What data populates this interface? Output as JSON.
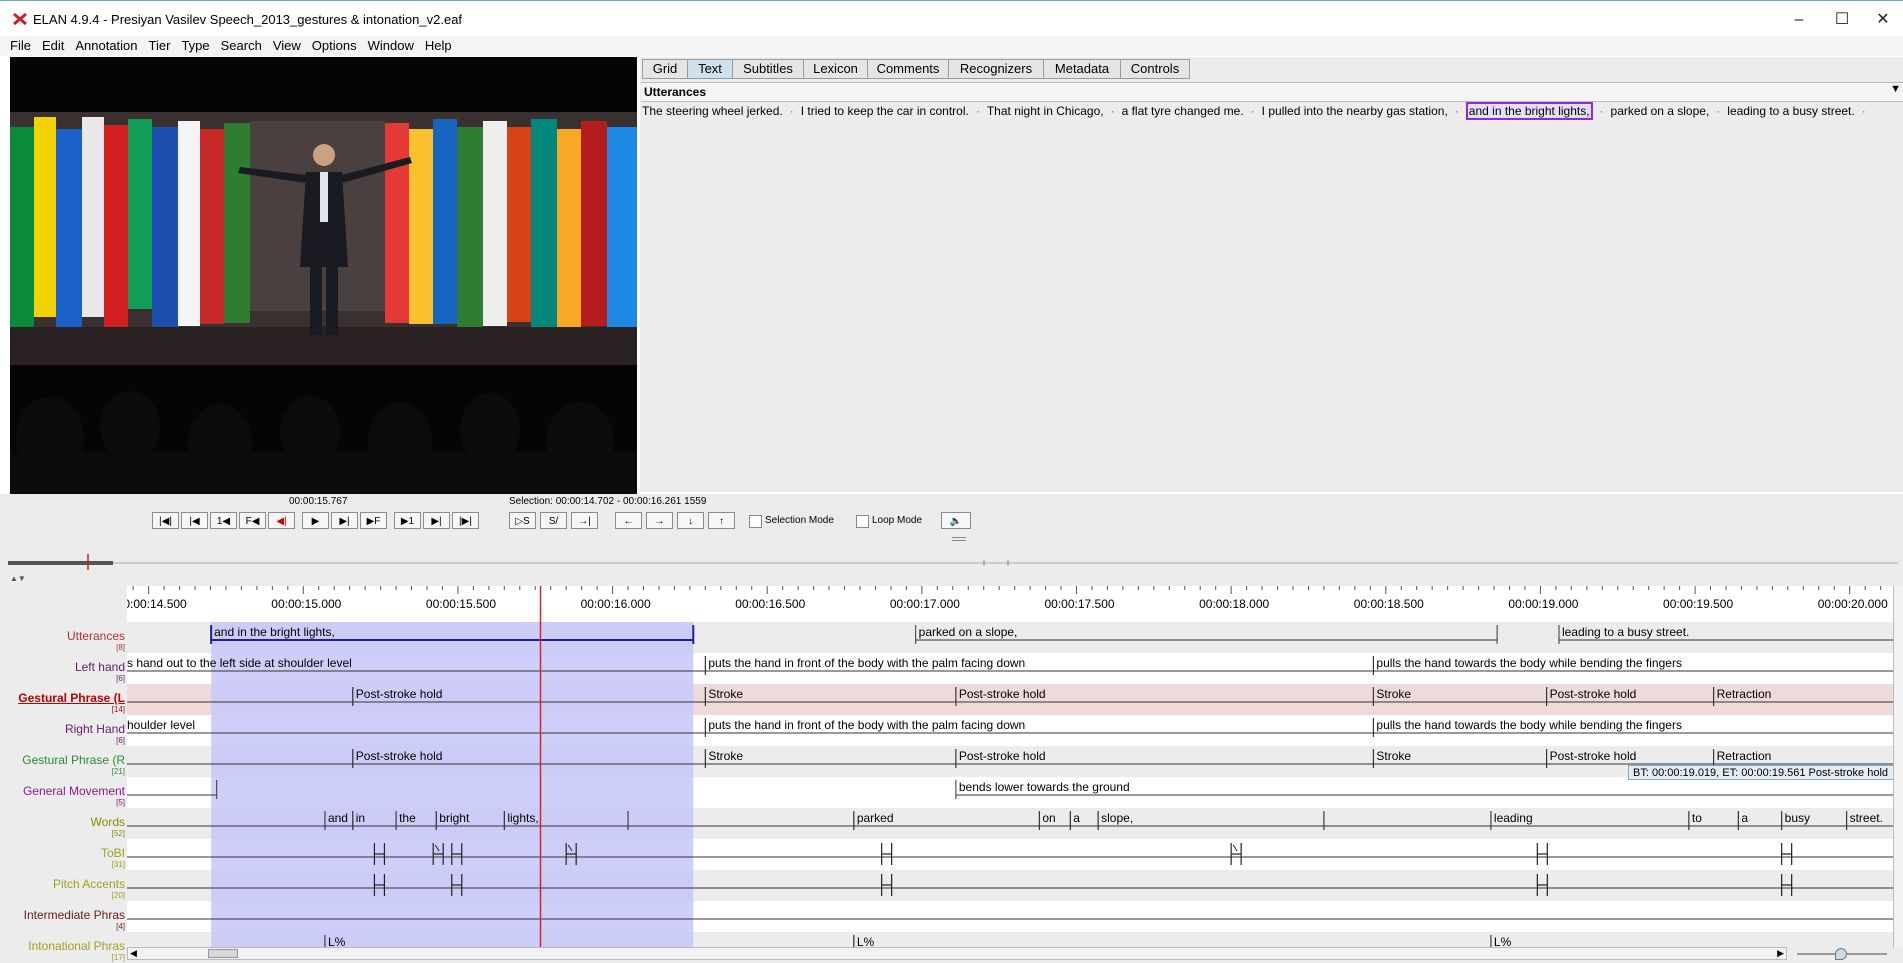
{
  "window": {
    "title": "ELAN 4.9.4 - Presiyan Vasilev Speech_2013_gestures & intonation_v2.eaf",
    "icon": "elan-logo-icon",
    "controls": [
      "minimize-icon",
      "maximize-icon",
      "close-icon"
    ]
  },
  "menu": [
    "File",
    "Edit",
    "Annotation",
    "Tier",
    "Type",
    "Search",
    "View",
    "Options",
    "Window",
    "Help"
  ],
  "tabs": [
    "Grid",
    "Text",
    "Subtitles",
    "Lexicon",
    "Comments",
    "Recognizers",
    "Metadata",
    "Controls"
  ],
  "active_tab": "Text",
  "text_view": {
    "tier": "Utterances",
    "utterances": [
      "The steering wheel jerked.",
      "I tried to keep the car in control.",
      "That night in Chicago,",
      "a flat tyre changed me.",
      "I pulled into the nearby gas station,",
      "and in the bright lights,",
      "parked on a slope,",
      "leading to a busy street."
    ],
    "selected_index": 5,
    "separator": "·"
  },
  "media": {
    "current_time": "00:00:15.767",
    "selection": "Selection: 00:00:14.702 - 00:00:16.261  1559",
    "selection_mode_label": "Selection Mode",
    "loop_mode_label": "Loop Mode",
    "selection_mode": false,
    "loop_mode": false
  },
  "timeline": {
    "view_start": 14.43,
    "view_end": 20.14,
    "crosshair": 15.767,
    "selection": [
      14.702,
      16.261
    ],
    "ticks": [
      "00:00:14.500",
      "00:00:15.000",
      "00:00:15.500",
      "00:00:16.000",
      "00:00:16.500",
      "00:00:17.000",
      "00:00:17.500",
      "00:00:18.000",
      "00:00:18.500",
      "00:00:19.000",
      "00:00:19.500",
      "00:00:20.000"
    ],
    "tick_times": [
      14.5,
      15.0,
      15.5,
      16.0,
      16.5,
      17.0,
      17.5,
      18.0,
      18.5,
      19.0,
      19.5,
      20.0
    ],
    "tooltip": "BT: 00:00:19.019, ET: 00:00:19.561 Post-stroke hold",
    "tiers": [
      {
        "name": "Utterances",
        "count": "[8]",
        "color": "#b0303c",
        "bold": false,
        "shaded": true,
        "anns": [
          {
            "s": 14.702,
            "e": 16.261,
            "t": "and in the bright lights,",
            "sel": true
          },
          {
            "s": 16.98,
            "e": 18.86,
            "t": "parked on a slope,"
          },
          {
            "s": 19.06,
            "e": 20.3,
            "t": "leading to a busy street."
          }
        ]
      },
      {
        "name": "Left hand",
        "count": "[6]",
        "color": "#6a1b6a",
        "bold": false,
        "shaded": false,
        "anns": [
          {
            "s": 14.0,
            "e": 16.3,
            "t": "s hand out to the left side at shoulder level"
          },
          {
            "s": 16.3,
            "e": 18.46,
            "t": "puts the hand in front of the body with the palm facing down"
          },
          {
            "s": 18.46,
            "e": 20.3,
            "t": "pulls the hand towards the body while bending the fingers"
          }
        ]
      },
      {
        "name": "Gestural Phrase (L",
        "count": "[14]",
        "color": "#c00000",
        "bold": true,
        "shaded": true,
        "active": true,
        "anns": [
          {
            "s": 14.0,
            "e": 15.16,
            "t": ""
          },
          {
            "s": 15.16,
            "e": 16.3,
            "t": "Post-stroke hold"
          },
          {
            "s": 16.3,
            "e": 17.11,
            "t": "Stroke"
          },
          {
            "s": 17.11,
            "e": 18.46,
            "t": "Post-stroke hold"
          },
          {
            "s": 18.46,
            "e": 19.02,
            "t": "Stroke"
          },
          {
            "s": 19.02,
            "e": 19.56,
            "t": "Post-stroke hold"
          },
          {
            "s": 19.56,
            "e": 20.3,
            "t": "Retraction"
          }
        ]
      },
      {
        "name": "Right Hand",
        "count": "[6]",
        "color": "#6a1b6a",
        "bold": false,
        "shaded": false,
        "anns": [
          {
            "s": 14.0,
            "e": 16.3,
            "t": "houlder level"
          },
          {
            "s": 16.3,
            "e": 18.46,
            "t": "puts the hand in front of the body with the palm facing down"
          },
          {
            "s": 18.46,
            "e": 20.3,
            "t": "pulls the hand towards the body while bending the fingers"
          }
        ]
      },
      {
        "name": "Gestural Phrase (R",
        "count": "[21]",
        "color": "#2e8b2e",
        "bold": false,
        "shaded": true,
        "anns": [
          {
            "s": 14.0,
            "e": 15.16,
            "t": ""
          },
          {
            "s": 15.16,
            "e": 16.3,
            "t": "Post-stroke hold"
          },
          {
            "s": 16.3,
            "e": 17.11,
            "t": "Stroke"
          },
          {
            "s": 17.11,
            "e": 18.46,
            "t": "Post-stroke hold"
          },
          {
            "s": 18.46,
            "e": 19.02,
            "t": "Stroke"
          },
          {
            "s": 19.02,
            "e": 19.56,
            "t": "Post-stroke hold"
          },
          {
            "s": 19.56,
            "e": 20.3,
            "t": "Retraction"
          }
        ]
      },
      {
        "name": "General Movement",
        "count": "[5]",
        "color": "#8b1a8b",
        "bold": false,
        "shaded": false,
        "anns": [
          {
            "s": 14.0,
            "e": 14.72,
            "t": ""
          },
          {
            "s": 17.11,
            "e": 20.3,
            "t": "bends lower towards the ground"
          }
        ]
      },
      {
        "name": "Words",
        "count": "[52]",
        "color": "#8a8a00",
        "bold": false,
        "shaded": true,
        "anns": [
          {
            "s": 14.0,
            "e": 15.07,
            "t": ""
          },
          {
            "s": 15.07,
            "e": 15.16,
            "t": "and"
          },
          {
            "s": 15.16,
            "e": 15.3,
            "t": "in"
          },
          {
            "s": 15.3,
            "e": 15.43,
            "t": "the"
          },
          {
            "s": 15.43,
            "e": 15.65,
            "t": "bright"
          },
          {
            "s": 15.65,
            "e": 16.05,
            "t": "lights,"
          },
          {
            "s": 16.05,
            "e": 16.78,
            "t": ""
          },
          {
            "s": 16.78,
            "e": 17.38,
            "t": "parked"
          },
          {
            "s": 17.38,
            "e": 17.48,
            "t": "on"
          },
          {
            "s": 17.48,
            "e": 17.57,
            "t": "a"
          },
          {
            "s": 17.57,
            "e": 18.3,
            "t": "slope,"
          },
          {
            "s": 18.3,
            "e": 18.84,
            "t": ""
          },
          {
            "s": 18.84,
            "e": 19.48,
            "t": "leading"
          },
          {
            "s": 19.48,
            "e": 19.64,
            "t": "to"
          },
          {
            "s": 19.64,
            "e": 19.78,
            "t": "a"
          },
          {
            "s": 19.78,
            "e": 19.99,
            "t": "busy"
          },
          {
            "s": 19.99,
            "e": 20.3,
            "t": "street."
          }
        ]
      },
      {
        "name": "ToBI",
        "count": "[31]",
        "color": "#a0a020",
        "bold": false,
        "shaded": false,
        "anns": []
      },
      {
        "name": "Pitch Accents",
        "count": "[20]",
        "color": "#a0a020",
        "bold": false,
        "shaded": true,
        "anns": []
      },
      {
        "name": "Intermediate Phras",
        "count": "[4]",
        "color": "#6a1b1b",
        "bold": false,
        "shaded": false,
        "anns": []
      },
      {
        "name": "Intonational Phras",
        "count": "[17]",
        "color": "#a0a020",
        "bold": false,
        "shaded": true,
        "anns": [
          {
            "s": 14.0,
            "e": 15.07,
            "t": ""
          },
          {
            "s": 15.07,
            "e": 16.78,
            "t": "L%"
          },
          {
            "s": 16.78,
            "e": 18.84,
            "t": "L%"
          },
          {
            "s": 18.84,
            "e": 20.3,
            "t": "L%"
          }
        ]
      }
    ],
    "tobi_marks": [
      15.23,
      15.42,
      15.48,
      15.85,
      16.87,
      18.0,
      18.99,
      19.78
    ],
    "tobi_marks_L": [
      15.42,
      15.85,
      18.0
    ],
    "pitch_marks": [
      15.23,
      15.48,
      16.87,
      18.99,
      19.78
    ]
  }
}
